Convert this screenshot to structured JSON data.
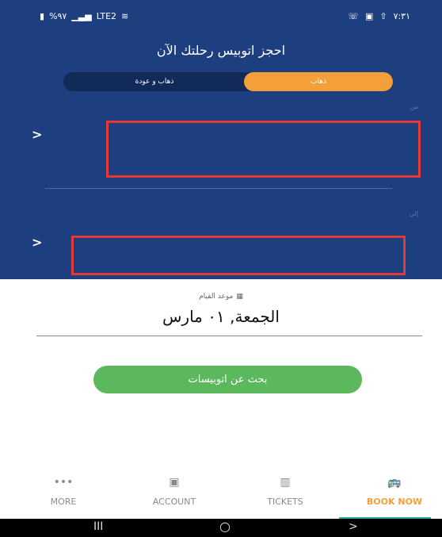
{
  "status_bar": {
    "battery": "%٩٧",
    "network": "LTE2",
    "time": "٧:٣١"
  },
  "header": {
    "title": "احجز اتوبيس رحلتك الآن"
  },
  "trip_type": {
    "one_way": "ذهاب",
    "round_trip": "ذهاب و عودة",
    "selected": "one_way"
  },
  "from": {
    "label": "من",
    "chevron": ">"
  },
  "to": {
    "label": "إلى",
    "chevron": ">"
  },
  "departure": {
    "label": "موعد القيام",
    "date": "الجمعة, ٠١ مارس"
  },
  "search": {
    "button_label": "بحث عن اتوبيسات"
  },
  "bottom_nav": [
    {
      "label": "MORE",
      "icon": "•••",
      "icon_name": "more-icon"
    },
    {
      "label": "ACCOUNT",
      "icon": "▣",
      "icon_name": "account-icon"
    },
    {
      "label": "TICKETS",
      "icon": "▥",
      "icon_name": "ticket-icon"
    },
    {
      "label": "BOOK NOW",
      "icon": "🚌",
      "icon_name": "bus-icon"
    }
  ],
  "system_nav": {
    "recents": "III",
    "home": "○",
    "back": ">"
  },
  "colors": {
    "primary": "#1d3f7f",
    "accent": "#f3a03b",
    "search": "#5cb85c",
    "highlight": "#e53935"
  }
}
